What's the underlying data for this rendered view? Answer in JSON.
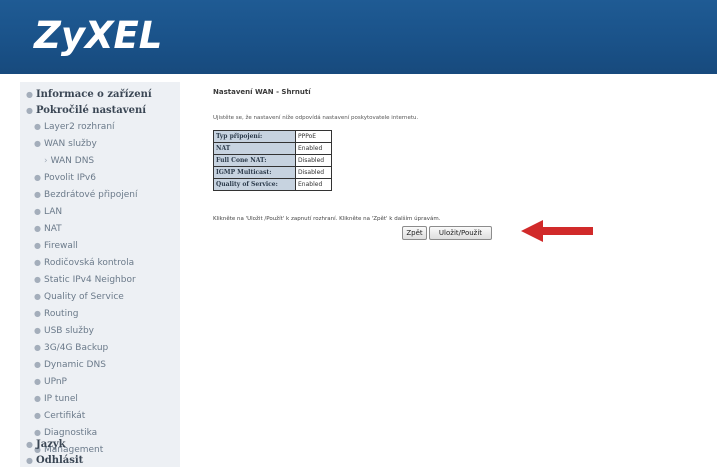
{
  "brand": {
    "logo_text": "ZyXEL"
  },
  "sidebar": {
    "items": [
      {
        "label": "Informace o zařízení",
        "level": "top"
      },
      {
        "label": "Pokročilé nastavení",
        "level": "top"
      },
      {
        "label": "Layer2 rozhraní",
        "level": "sub"
      },
      {
        "label": "WAN služby",
        "level": "sub"
      },
      {
        "label": "WAN DNS",
        "level": "subsub"
      },
      {
        "label": "Povolit IPv6",
        "level": "sub"
      },
      {
        "label": "Bezdrátové připojení",
        "level": "sub"
      },
      {
        "label": "LAN",
        "level": "sub"
      },
      {
        "label": "NAT",
        "level": "sub"
      },
      {
        "label": "Firewall",
        "level": "sub"
      },
      {
        "label": "Rodičovská kontrola",
        "level": "sub"
      },
      {
        "label": "Static IPv4 Neighbor",
        "level": "sub"
      },
      {
        "label": "Quality of Service",
        "level": "sub"
      },
      {
        "label": "Routing",
        "level": "sub"
      },
      {
        "label": "USB služby",
        "level": "sub"
      },
      {
        "label": "3G/4G Backup",
        "level": "sub"
      },
      {
        "label": "Dynamic DNS",
        "level": "sub"
      },
      {
        "label": "UPnP",
        "level": "sub"
      },
      {
        "label": "IP tunel",
        "level": "sub"
      },
      {
        "label": "Certifikát",
        "level": "sub"
      },
      {
        "label": "Diagnostika",
        "level": "sub"
      },
      {
        "label": "Management",
        "level": "sub"
      },
      {
        "label": "Jazyk",
        "level": "top"
      },
      {
        "label": "Odhlásit",
        "level": "top"
      }
    ]
  },
  "main": {
    "title": "Nastavení WAN - Shrnutí",
    "note": "Ujistěte se, že nastavení níže odpovídá nastavení poskytovatele internetu.",
    "summary": [
      {
        "label": "Typ připojení:",
        "value": "PPPoE"
      },
      {
        "label": "NAT",
        "value": "Enabled"
      },
      {
        "label": "Full Cone NAT:",
        "value": "Disabled"
      },
      {
        "label": "IGMP Multicast:",
        "value": "Disabled"
      },
      {
        "label": "Quality of Service:",
        "value": "Enabled"
      }
    ],
    "hint": "Klikněte na 'Uložit /Použít' k zapnutí rozhraní. Klikněte na 'Zpět' k dalším úpravám.",
    "buttons": {
      "back": "Zpět",
      "apply": "Uložit/Použít"
    }
  },
  "colors": {
    "header_bg": "#1a5289",
    "sidebar_bg": "#edf0f4",
    "table_label_bg": "#c7d3e0",
    "arrow": "#d12a2a"
  },
  "icons": {
    "arrow": "left-arrow-icon",
    "bullet": "bullet-icon",
    "submenu": "chevron-right-icon"
  }
}
